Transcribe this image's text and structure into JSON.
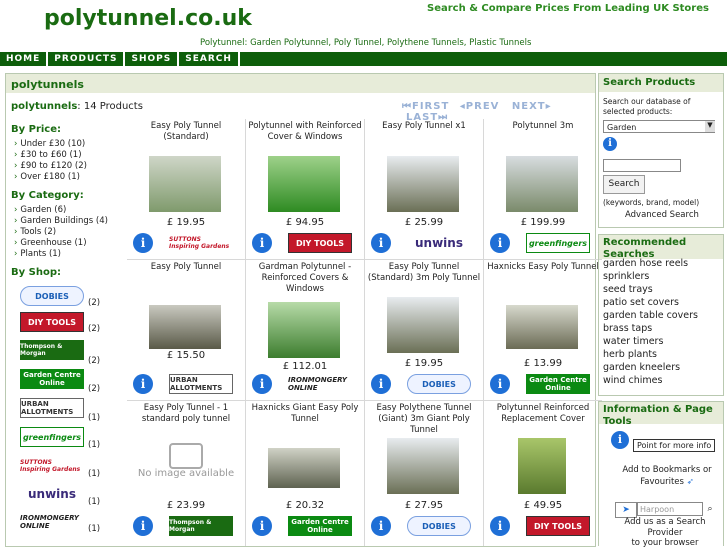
{
  "header": {
    "site_title": "polytunnel.co.uk",
    "tagline": "Search & Compare Prices From Leading UK Stores",
    "subtitle": "Polytunnel: Garden Polytunnel, Poly Tunnel, Polythene Tunnels, Plastic Tunnels"
  },
  "nav": [
    "HOME",
    "PRODUCTS",
    "SHOPS",
    "SEARCH"
  ],
  "main": {
    "title": "polytunnels",
    "count_label": "polytunnels",
    "count_text": ": 14 Products",
    "pager": {
      "first": "FIRST",
      "prev": "PREV",
      "next": "NEXT",
      "last": "LAST"
    }
  },
  "filters": {
    "price_head": "By Price:",
    "price": [
      "Under £30 (10)",
      "£30 to £60 (1)",
      "£90 to £120 (2)",
      "Over £180 (1)"
    ],
    "category_head": "By Category:",
    "category": [
      "Garden (6)",
      "Garden Buildings (4)",
      "Tools (2)",
      "Greenhouse (1)",
      "Plants (1)"
    ],
    "shop_head": "By Shop:",
    "shops": [
      {
        "logo": "DOBIES",
        "count": "(2)"
      },
      {
        "logo": "DIY TOOLS",
        "count": "(2)"
      },
      {
        "logo": "Thompson & Morgan",
        "count": "(2)"
      },
      {
        "logo": "Garden Centre Online",
        "count": "(2)"
      },
      {
        "logo": "URBAN ALLOTMENTS",
        "count": "(1)"
      },
      {
        "logo": "greenfingers",
        "count": "(1)"
      },
      {
        "logo": "SUTTONS Inspiring Gardens",
        "count": "(1)"
      },
      {
        "logo": "unwins",
        "count": "(1)"
      },
      {
        "logo": "IRONMONGERY ONLINE",
        "count": "(1)"
      }
    ]
  },
  "products": [
    {
      "title": "Easy Poly Tunnel (Standard)",
      "price": "£ 19.95",
      "shop": "SUTTONS Inspiring Gardens"
    },
    {
      "title": "Polytunnel with Reinforced Cover & Windows",
      "price": "£ 94.95",
      "shop": "DIY TOOLS"
    },
    {
      "title": "Easy Poly Tunnel x1",
      "price": "£ 25.99",
      "shop": "unwins"
    },
    {
      "title": "Polytunnel 3m",
      "price": "£ 199.99",
      "shop": "greenfingers"
    },
    {
      "title": "Easy Poly Tunnel",
      "price": "£ 15.50",
      "shop": "URBAN ALLOTMENTS"
    },
    {
      "title": "Gardman Polytunnel - Reinforced Covers & Windows",
      "price": "£ 112.01",
      "shop": "IRONMONGERY ONLINE"
    },
    {
      "title": "Easy Poly Tunnel (Standard) 3m Poly Tunnel",
      "price": "£ 19.95",
      "shop": "DOBIES"
    },
    {
      "title": "Haxnicks Easy Poly Tunnel",
      "price": "£ 13.99",
      "shop": "Garden Centre Online"
    },
    {
      "title": "Easy Poly Tunnel - 1 standard poly tunnel",
      "price": "£ 23.99",
      "shop": "Thompson & Morgan",
      "no_image": "No image available"
    },
    {
      "title": "Haxnicks Giant Easy Poly Tunnel",
      "price": "£ 20.32",
      "shop": "Garden Centre Online"
    },
    {
      "title": "Easy Polythene Tunnel (Giant) 3m Giant Poly Tunnel",
      "price": "£ 27.95",
      "shop": "DOBIES"
    },
    {
      "title": "Polytunnel Reinforced Replacement Cover",
      "price": "£ 49.95",
      "shop": "DIY TOOLS"
    }
  ],
  "sidebar": {
    "search_head": "Search Products",
    "search_desc": "Search our database of selected products:",
    "search_select": "Garden",
    "search_button": "Search",
    "search_hint": "(keywords, brand, model)",
    "advanced": "Advanced Search",
    "rec_head": "Recommended Searches",
    "rec_items": [
      "garden hose reels",
      "sprinklers",
      "seed trays",
      "patio set covers",
      "garden table covers",
      "brass taps",
      "water timers",
      "herb plants",
      "garden kneelers",
      "wind chimes"
    ],
    "info_head": "Information & Page Tools",
    "tooltip": "Point for more info",
    "bookmark": "Add to Bookmarks or Favourites",
    "search_placeholder": "Harpoon",
    "search_provider": "Add us as a Search Provider",
    "browser": "to your browser"
  },
  "colors": {
    "brand_green": "#1a6b12",
    "nav_bg": "#0d5e0a",
    "panel_head": "#e7ecd9",
    "info_blue": "#1f6fd6"
  }
}
